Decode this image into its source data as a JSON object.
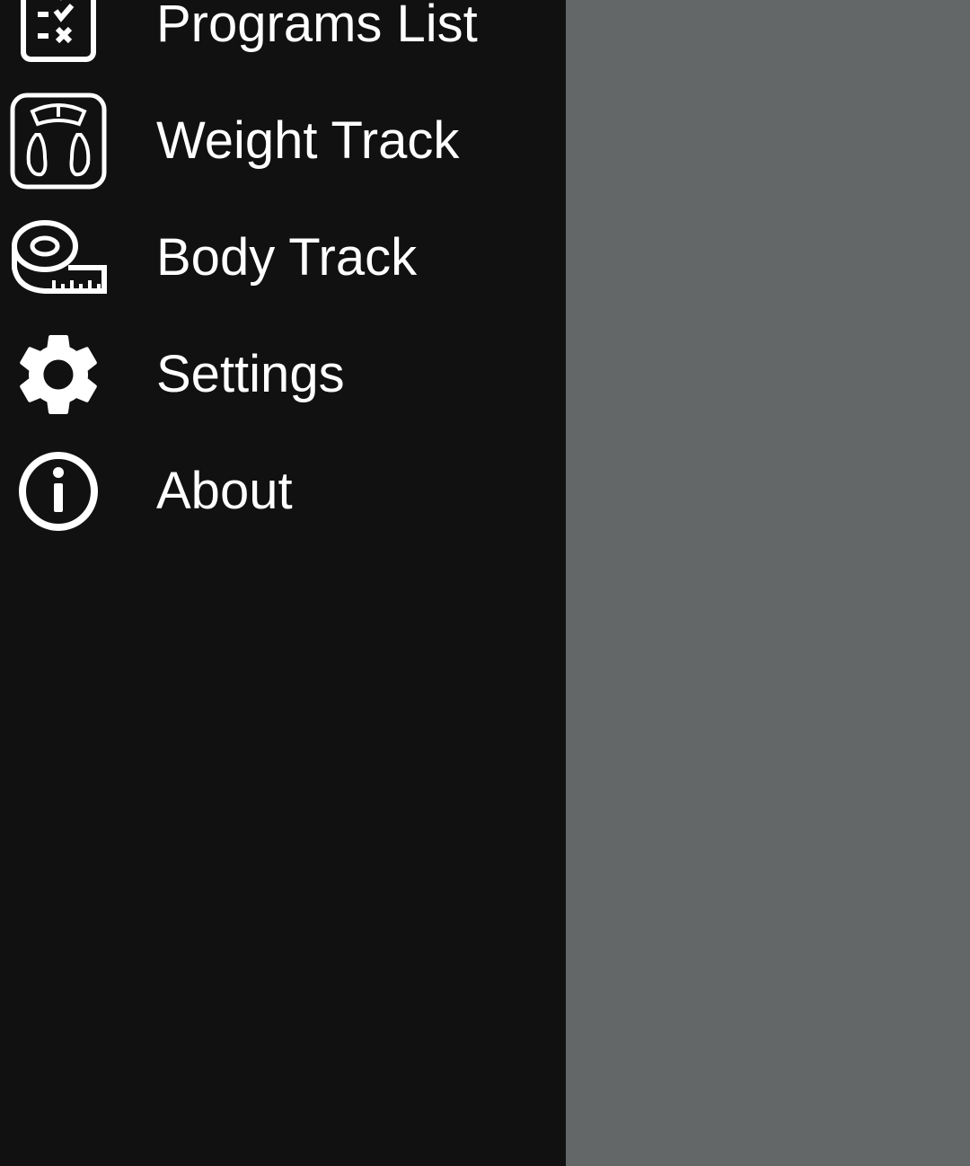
{
  "drawer": {
    "background": "#111111",
    "items": [
      {
        "label": "Programs List",
        "icon": "checklist-icon"
      },
      {
        "label": "Weight Track",
        "icon": "scale-icon"
      },
      {
        "label": "Body Track",
        "icon": "measuring-tape-icon"
      },
      {
        "label": "Settings",
        "icon": "gear-icon"
      },
      {
        "label": "About",
        "icon": "info-icon"
      }
    ]
  },
  "scrim": {
    "color": "#636768"
  }
}
